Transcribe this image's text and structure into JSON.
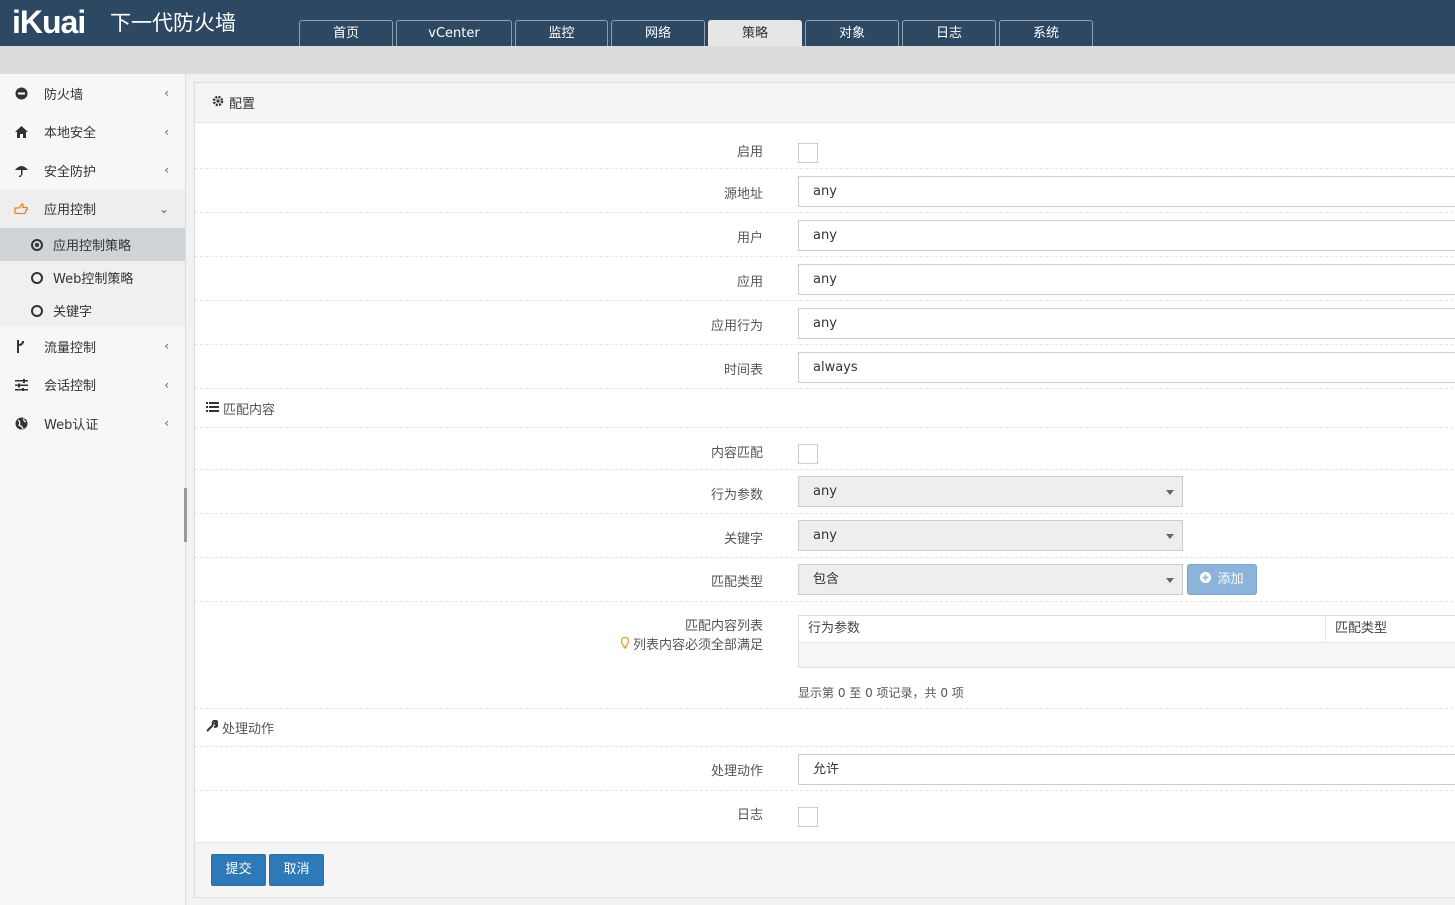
{
  "header": {
    "logo": "iKuai",
    "title": "下一代防火墙",
    "tabs": [
      {
        "label": "首页",
        "active": false
      },
      {
        "label": "vCenter",
        "active": false
      },
      {
        "label": "监控",
        "active": false
      },
      {
        "label": "网络",
        "active": false
      },
      {
        "label": "策略",
        "active": true
      },
      {
        "label": "对象",
        "active": false
      },
      {
        "label": "日志",
        "active": false
      },
      {
        "label": "系统",
        "active": false
      }
    ]
  },
  "sidebar": {
    "items": [
      {
        "label": "防火墙",
        "icon": "minus-circle-icon"
      },
      {
        "label": "本地安全",
        "icon": "home-icon"
      },
      {
        "label": "安全防护",
        "icon": "umbrella-icon"
      },
      {
        "label": "应用控制",
        "icon": "hand-pointer-icon",
        "open": true
      },
      {
        "label": "流量控制",
        "icon": "branch-icon"
      },
      {
        "label": "会话控制",
        "icon": "sliders-icon"
      },
      {
        "label": "Web认证",
        "icon": "globe-icon"
      }
    ],
    "subitems": [
      {
        "label": "应用控制策略",
        "active": true
      },
      {
        "label": "Web控制策略",
        "active": false
      },
      {
        "label": "关键字",
        "active": false
      }
    ]
  },
  "panel": {
    "title": "配置",
    "fields": {
      "enable_label": "启用",
      "src_label": "源地址",
      "src_value": "any",
      "user_label": "用户",
      "user_value": "any",
      "app_label": "应用",
      "app_value": "any",
      "behavior_label": "应用行为",
      "behavior_value": "any",
      "schedule_label": "时间表",
      "schedule_value": "always"
    },
    "match_section": "匹配内容",
    "match": {
      "content_match_label": "内容匹配",
      "param_label": "行为参数",
      "param_value": "any",
      "keyword_label": "关键字",
      "keyword_value": "any",
      "type_label": "匹配类型",
      "type_value": "包含",
      "add_label": "添加",
      "list_label": "匹配内容列表",
      "list_hint": "列表内容必须全部满足",
      "list_columns": [
        "行为参数",
        "匹配类型"
      ],
      "records": "显示第 0 至 0 项记录，共 0 项"
    },
    "action_section": "处理动作",
    "action": {
      "action_label": "处理动作",
      "action_value": "允许",
      "log_label": "日志"
    },
    "submit_label": "提交",
    "cancel_label": "取消"
  },
  "colors": {
    "header_bg": "#2d4863",
    "primary_button": "#2e7ab8",
    "add_button": "#8cb3d9",
    "accent_icon": "#e8852b"
  }
}
